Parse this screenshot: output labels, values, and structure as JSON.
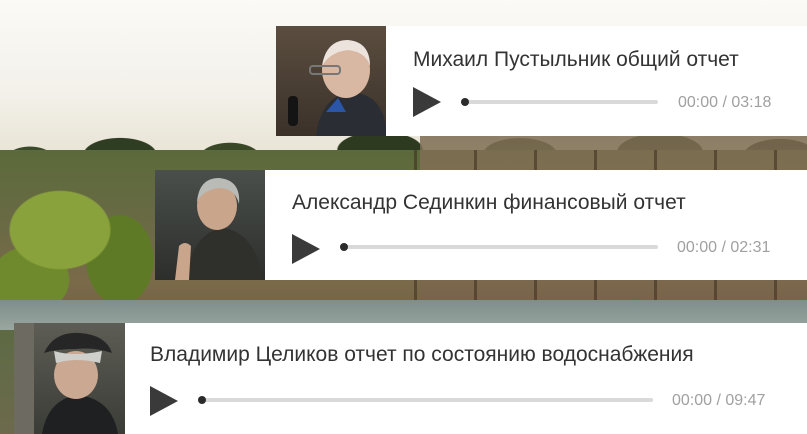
{
  "tracks": [
    {
      "title": "Михаил Пустыльник общий отчет",
      "time": "00:00 / 03:18",
      "progress": 0,
      "thumbnail": "portrait-older-man-bald-glasses-microphone"
    },
    {
      "title": "Александр Сединкин финансовый отчет",
      "time": "00:00 / 02:31",
      "progress": 0,
      "thumbnail": "portrait-man-gray-hair-speaking"
    },
    {
      "title": "Владимир Целиков отчет по состоянию водоснабжения",
      "time": "00:00 / 09:47",
      "progress": 0,
      "thumbnail": "portrait-man-flat-cap"
    }
  ],
  "colors": {
    "card_bg": "#ffffff",
    "title": "#333333",
    "time": "#a0a0a0",
    "play": "#3a3a3a",
    "track": "#d9d9d9",
    "knob": "#2b2b2b"
  }
}
